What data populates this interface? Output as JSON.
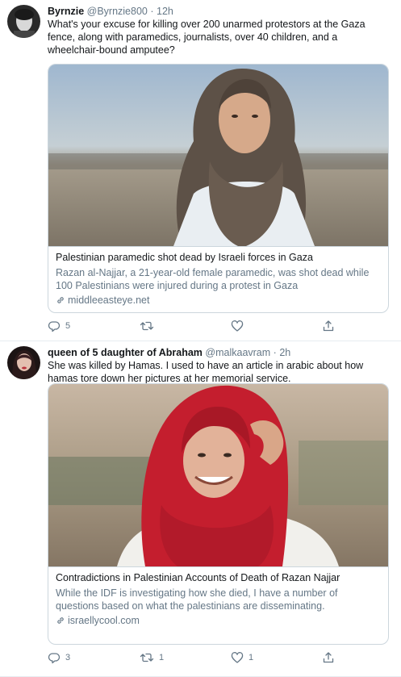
{
  "tweets": [
    {
      "name": "Byrnzie",
      "handle": "@Byrnzie800",
      "sep": "·",
      "time": "12h",
      "text": "What's your excuse for killing over 200 unarmed protestors at the Gaza fence, along with paramedics, journalists, over 40 children, and a wheelchair-bound amputee?",
      "card": {
        "title": "Palestinian paramedic shot dead by Israeli forces in Gaza",
        "description": "Razan al-Najjar, a 21-year-old female paramedic, was shot dead while 100 Palestinians were injured during a protest in Gaza",
        "domain": "middleeasteye.net"
      },
      "reply_count": "5",
      "retweet_count": "",
      "like_count": ""
    },
    {
      "name": "queen of 5 daughter of Abraham",
      "handle": "@malkaavram",
      "sep": "·",
      "time": "2h",
      "text": "She was killed by Hamas.  I used to have an article in arabic about how hamas tore down her pictures at her memorial service.",
      "card": {
        "title": "Contradictions in Palestinian Accounts of Death of Razan Najjar",
        "description": "While the IDF is investigating how she died, I have a number of questions based on what the palestinians are disseminating.",
        "domain": "israellycool.com"
      },
      "reply_count": "3",
      "retweet_count": "1",
      "like_count": "1"
    }
  ],
  "colors": {
    "text": "#14171a",
    "secondary": "#657786",
    "border": "#ccd6dd",
    "scarf_red": "#c41e2e",
    "hijab_gray": "#5a5048"
  },
  "icons": [
    "reply-icon",
    "retweet-icon",
    "like-icon",
    "share-icon",
    "link-icon"
  ]
}
